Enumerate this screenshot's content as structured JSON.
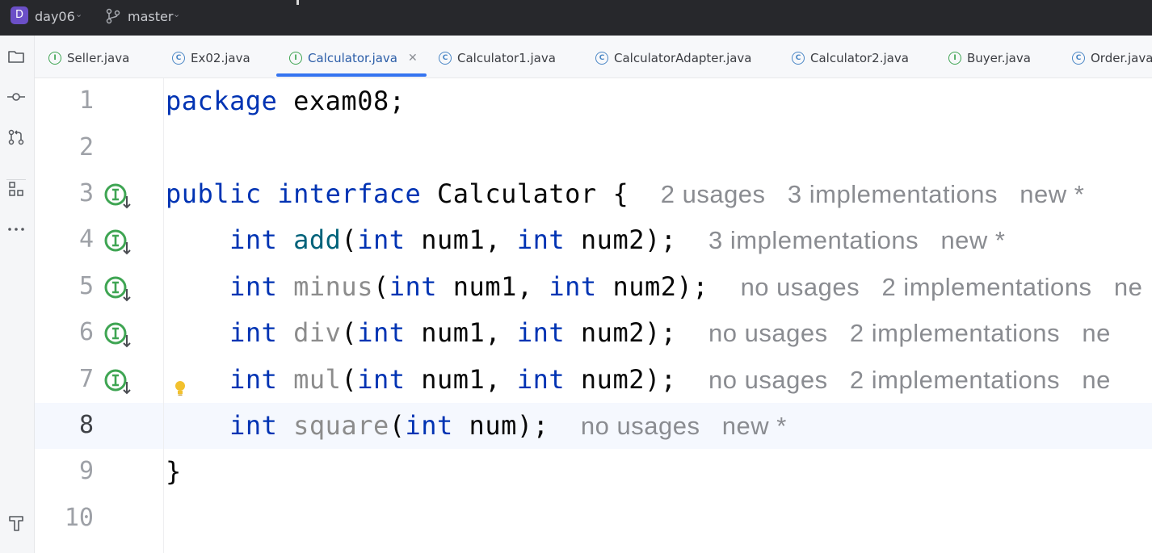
{
  "titlebar": {
    "project_initial": "D",
    "project_name": "day06",
    "branch_name": "master"
  },
  "toolstrip": {
    "items": [
      "folder-icon",
      "commit-icon",
      "pull-requests-icon",
      "structure-icon",
      "more-icon",
      "build-hammer-icon"
    ]
  },
  "tabs": [
    {
      "label": "Seller.java",
      "kind": "interface"
    },
    {
      "label": "Ex02.java",
      "kind": "class-run"
    },
    {
      "label": "Calculator.java",
      "kind": "interface",
      "active": true
    },
    {
      "label": "Calculator1.java",
      "kind": "class"
    },
    {
      "label": "CalculatorAdapter.java",
      "kind": "class"
    },
    {
      "label": "Calculator2.java",
      "kind": "class"
    },
    {
      "label": "Buyer.java",
      "kind": "interface"
    },
    {
      "label": "Order.java",
      "kind": "class"
    }
  ],
  "editor": {
    "line_numbers": [
      "1",
      "2",
      "3",
      "4",
      "5",
      "6",
      "7",
      "8",
      "9",
      "10"
    ],
    "current_line": "8",
    "lines": {
      "l1": {
        "kw": "package",
        "rest": " exam08;"
      },
      "l3": {
        "kw1": "public",
        "kw2": "interface",
        "rest": "Calculator {",
        "hint": "2 usages   3 implementations   new *"
      },
      "l4": {
        "type": "int",
        "name": "add",
        "p1": "int",
        "a1": " num1, ",
        "p2": "int",
        "a2": " num2);",
        "hint": "3 implementations   new *"
      },
      "l5": {
        "type": "int",
        "name": "minus",
        "p1": "int",
        "a1": " num1, ",
        "p2": "int",
        "a2": " num2);",
        "hint": "no usages   2 implementations   ne"
      },
      "l6": {
        "type": "int",
        "name": "div",
        "p1": "int",
        "a1": " num1, ",
        "p2": "int",
        "a2": " num2);",
        "hint": "no usages   2 implementations   ne"
      },
      "l7": {
        "type": "int",
        "name": "mul",
        "p1": "int",
        "a1": " num1, ",
        "p2": "int",
        "a2": " num2);",
        "hint": "no usages   2 implementations   ne"
      },
      "l8": {
        "type": "int",
        "name": "square",
        "p1": "int",
        "a1": " num);",
        "hint": "no usages   new *"
      },
      "l9": {
        "rest": "}"
      }
    },
    "gutter_icon": "implemented-interface-method-icon",
    "colors": {
      "keyword": "#0033b3",
      "method": "#00627a",
      "unused_method": "#8c8c8c",
      "hint": "#8a8c91",
      "accent": "#3574f0"
    }
  }
}
